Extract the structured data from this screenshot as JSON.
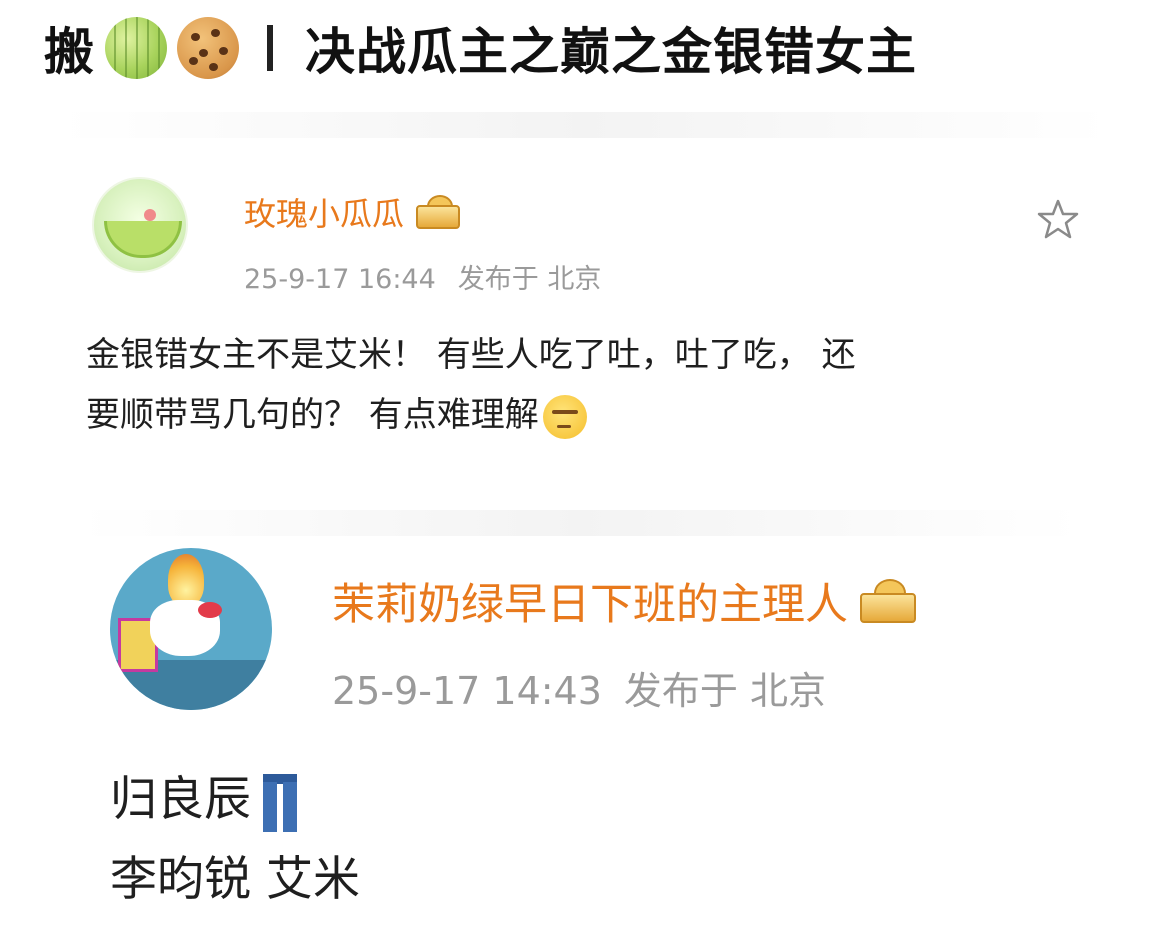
{
  "header": {
    "prefix": "搬",
    "icons": [
      "melon-emoji",
      "cookie-emoji"
    ],
    "title": "决战瓜主之巅之金银错女主"
  },
  "posts": [
    {
      "username": "玫瑰小瓜瓜",
      "date": "25-9-17 16:44",
      "location_label": "发布于 北京",
      "body_line1": "金银错女主不是艾米！ 有些人吃了吐，吐了吃， 还",
      "body_line2": "要顺带骂几句的？ 有点难理解",
      "avatar_icon": "melon-avatar",
      "badge_icon": "crown-badge-icon",
      "emoji": "thinking-face-emoji"
    },
    {
      "username": "茉莉奶绿早日下班的主理人",
      "date": "25-9-17 14:43",
      "location_label": "发布于 北京",
      "body_line1": "归良辰",
      "body_line2": "李昀锐 艾米",
      "avatar_icon": "hello-kitty-avatar",
      "badge_icon": "crown-badge-icon",
      "emoji": "jeans-emoji"
    }
  ],
  "colors": {
    "username": "#e8791c",
    "meta": "#9a9a9a",
    "text": "#1f1f1f"
  }
}
